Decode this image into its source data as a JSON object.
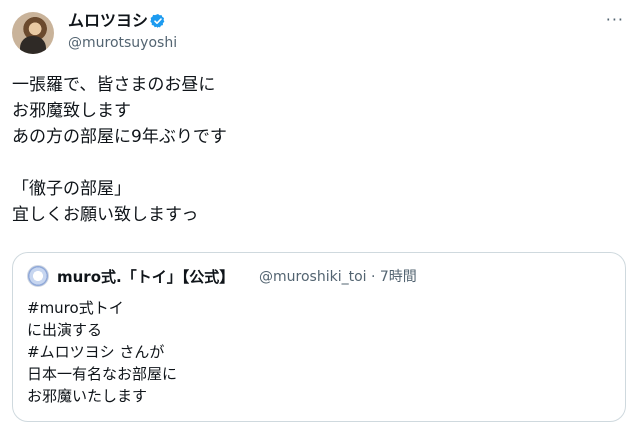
{
  "author": {
    "display_name": "ムロツヨシ",
    "handle": "@murotsuyoshi",
    "verified": true,
    "verified_color": "#1d9bf0",
    "more_icon": "more-horizontal-icon",
    "more_glyph": "···"
  },
  "tweet": {
    "lines": [
      "一張羅で、皆さまのお昼に",
      "お邪魔致します",
      "あの方の部屋に9年ぶりです",
      "",
      "「徹子の部屋」",
      "宜しくお願い致しますっ"
    ]
  },
  "quote": {
    "display_name": "muro式.「トイ」【公式】",
    "handle": "@muroshiki_toi",
    "time": "· 7時間",
    "lines": [
      "#muro式トイ",
      "に出演する",
      "#ムロツヨシ さんが",
      "日本一有名なお部屋に",
      "お邪魔いたします"
    ]
  },
  "colors": {
    "text": "#0f1419",
    "secondary": "#536471",
    "border": "#cfd9de"
  }
}
